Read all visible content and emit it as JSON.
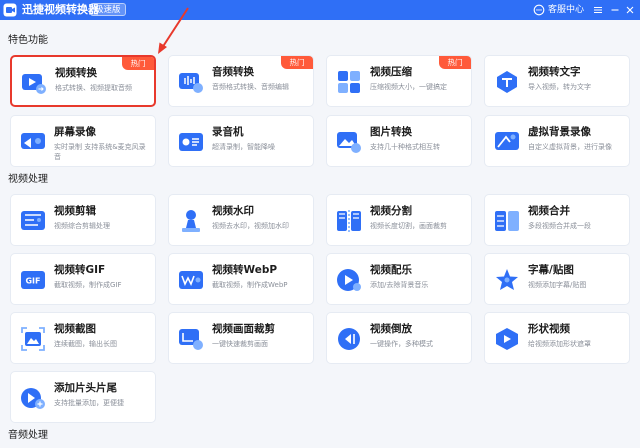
{
  "titlebar": {
    "app_name": "迅捷视频转换器",
    "edition": "极速版",
    "customer_service": "客服中心",
    "icons": [
      "app-logo",
      "chat-bubble-icon",
      "menu-icon",
      "minimize-icon",
      "close-icon"
    ]
  },
  "colors": {
    "primary": "#2f6ff6",
    "hot": "#ff5a3a",
    "highlight": "#e8392c"
  },
  "sections": [
    {
      "title": "特色功能"
    },
    {
      "title": "视频处理"
    },
    {
      "title": "音频处理"
    }
  ],
  "cards": [
    {
      "title": "视频转换",
      "desc": "格式转换、视频提取音频",
      "badge": "热门",
      "icon": "video-convert-icon"
    },
    {
      "title": "音频转换",
      "desc": "音频格式转换、音频编辑",
      "badge": "热门",
      "icon": "audio-convert-icon"
    },
    {
      "title": "视频压缩",
      "desc": "压缩视频大小，一键搞定",
      "badge": "热门",
      "icon": "video-compress-icon"
    },
    {
      "title": "视频转文字",
      "desc": "导入视频，转为文字",
      "icon": "video-to-text-icon"
    },
    {
      "title": "屏幕录像",
      "desc": "实时录制 支持系统&麦克风录音",
      "icon": "screen-record-icon"
    },
    {
      "title": "录音机",
      "desc": "超清录制，智能降噪",
      "icon": "recorder-icon"
    },
    {
      "title": "图片转换",
      "desc": "支持几十种格式相互转",
      "icon": "image-convert-icon"
    },
    {
      "title": "虚拟背景录像",
      "desc": "自定义虚拟背景，进行录像",
      "icon": "virtual-bg-icon"
    },
    {
      "title": "视频剪辑",
      "desc": "视频综合剪辑处理",
      "icon": "video-edit-icon"
    },
    {
      "title": "视频水印",
      "desc": "视频去水印，视频加水印",
      "icon": "watermark-icon"
    },
    {
      "title": "视频分割",
      "desc": "视频长度切割，画面裁剪",
      "icon": "video-split-icon"
    },
    {
      "title": "视频合并",
      "desc": "多段视频合并成一段",
      "icon": "video-merge-icon"
    },
    {
      "title": "视频转GIF",
      "desc": "截取视频，制作成GIF",
      "icon": "gif-icon"
    },
    {
      "title": "视频转WebP",
      "desc": "截取视频，制作成WebP",
      "icon": "webp-icon"
    },
    {
      "title": "视频配乐",
      "desc": "添加/去除背景音乐",
      "icon": "music-icon"
    },
    {
      "title": "字幕/贴图",
      "desc": "视频添加字幕/贴图",
      "icon": "subtitle-icon"
    },
    {
      "title": "视频截图",
      "desc": "连续截图，输出长图",
      "icon": "screenshot-icon"
    },
    {
      "title": "视频画面裁剪",
      "desc": "一键快速裁剪画面",
      "icon": "crop-icon"
    },
    {
      "title": "视频倒放",
      "desc": "一键操作，多种模式",
      "icon": "reverse-icon"
    },
    {
      "title": "形状视频",
      "desc": "给视频添加形状遮罩",
      "icon": "shape-icon"
    },
    {
      "title": "添加片头片尾",
      "desc": "支持批量添加，更便捷",
      "icon": "intro-outro-icon"
    }
  ]
}
